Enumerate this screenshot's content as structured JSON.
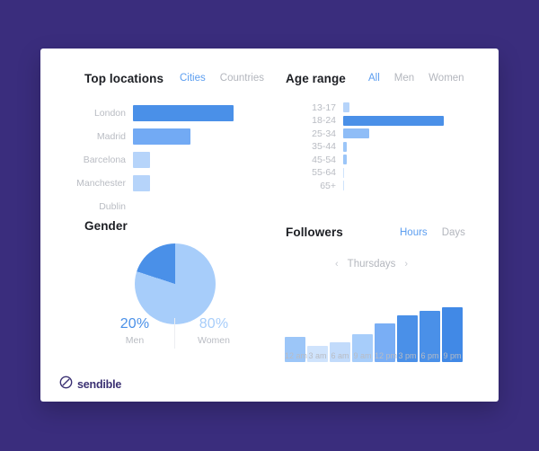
{
  "theme": {
    "page_background": "#3a2d7d",
    "card_background": "#ffffff",
    "accent_blue": "#5c9ef0",
    "blue_dark": "#4a90e8",
    "blue_mid": "#72aaf4",
    "blue_light": "#b6d4fa",
    "blue_lighter": "#cfe3fc",
    "label_gray": "#b9bcc3",
    "title_dark": "#1d1f24",
    "brand_purple": "#3b3173"
  },
  "brand": {
    "name": "sendible",
    "logo_icon": "sendible-circle-slash-icon"
  },
  "panels": {
    "locations": {
      "title": "Top locations",
      "tabs": [
        {
          "label": "Cities",
          "active": true
        },
        {
          "label": "Countries",
          "active": false
        }
      ]
    },
    "age": {
      "title": "Age range",
      "tabs": [
        {
          "label": "All",
          "active": true
        },
        {
          "label": "Men",
          "active": false
        },
        {
          "label": "Women",
          "active": false
        }
      ]
    },
    "gender": {
      "title": "Gender"
    },
    "followers": {
      "title": "Followers",
      "tabs": [
        {
          "label": "Hours",
          "active": true
        },
        {
          "label": "Days",
          "active": false
        }
      ],
      "day_nav": {
        "prev_icon": "chevron-left-icon",
        "next_icon": "chevron-right-icon",
        "day": "Thursdays"
      }
    }
  },
  "chart_data": [
    {
      "type": "bar",
      "id": "top-locations",
      "orientation": "horizontal",
      "title": "Top locations",
      "xlabel": "",
      "ylabel": "",
      "categories": [
        "London",
        "Madrid",
        "Barcelona",
        "Manchester",
        "Dublin"
      ],
      "values": [
        100,
        57,
        17,
        17,
        0
      ],
      "xlim": [
        0,
        100
      ],
      "grid": false,
      "legend": "none",
      "colors": [
        "#4a90e8",
        "#72aaf4",
        "#b6d4fa",
        "#b6d4fa",
        "#b6d4fa"
      ]
    },
    {
      "type": "bar",
      "id": "age-range",
      "orientation": "horizontal",
      "title": "Age range",
      "xlabel": "",
      "ylabel": "",
      "categories": [
        "13-17",
        "18-24",
        "25-34",
        "35-44",
        "45-54",
        "55-64",
        "65+"
      ],
      "values": [
        6,
        100,
        26,
        4,
        4,
        1,
        1
      ],
      "xlim": [
        0,
        100
      ],
      "grid": false,
      "legend": "none",
      "colors": [
        "#b6d4fa",
        "#4a90e8",
        "#8fbdf7",
        "#9cc6f8",
        "#9cc6f8",
        "#cfe3fc",
        "#cfe3fc"
      ]
    },
    {
      "type": "pie",
      "id": "gender",
      "title": "Gender",
      "labels": [
        "Men",
        "Women"
      ],
      "values": [
        20,
        80
      ],
      "value_labels": [
        "20%",
        "80%"
      ],
      "colors": [
        "#4a90e8",
        "#a7cdfa"
      ],
      "legend": "bottom"
    },
    {
      "type": "bar",
      "id": "followers-by-hour",
      "orientation": "vertical",
      "title": "Followers",
      "xlabel": "",
      "ylabel": "",
      "categories": [
        "12 am",
        "3 am",
        "6 am",
        "9 am",
        "12 pm",
        "3 pm",
        "6 pm",
        "9 pm"
      ],
      "values": [
        38,
        24,
        29,
        42,
        58,
        70,
        76,
        82
      ],
      "ylim": [
        0,
        100
      ],
      "grid": false,
      "legend": "none",
      "colors": [
        "#9cc6f8",
        "#cfe3fc",
        "#c2dbfb",
        "#a7cdfa",
        "#79aef5",
        "#4a90e8",
        "#4a90e8",
        "#4189e6"
      ]
    }
  ]
}
